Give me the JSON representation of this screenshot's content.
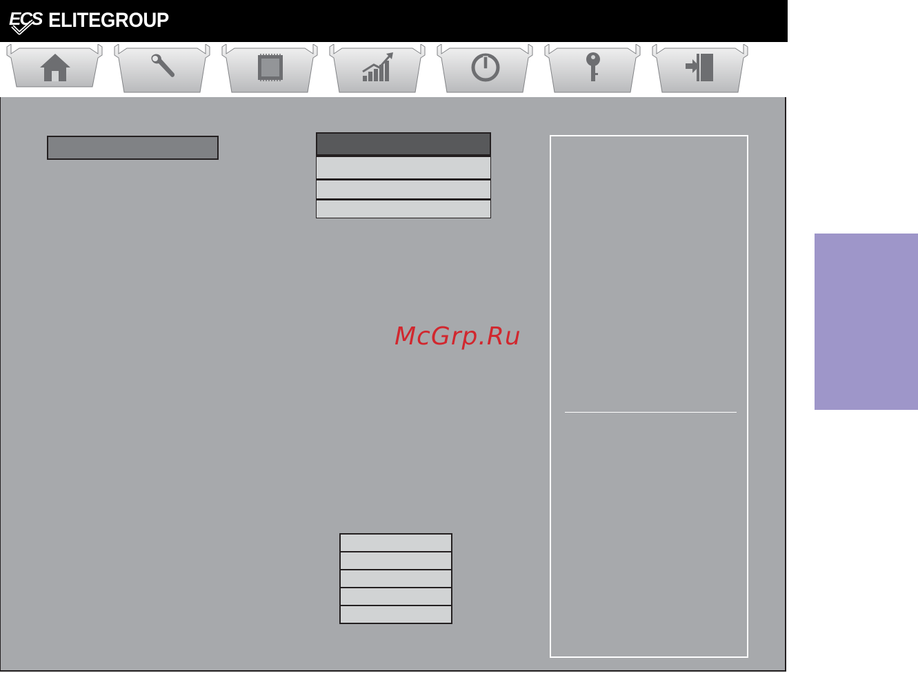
{
  "brand": {
    "mark": "ECS",
    "name": "ELITEGROUP"
  },
  "tabs": [
    {
      "id": "main",
      "icon": "home-icon",
      "active": true
    },
    {
      "id": "advanced",
      "icon": "wrench-icon"
    },
    {
      "id": "chipset",
      "icon": "chip-icon"
    },
    {
      "id": "mb-intelligent-tweaker",
      "icon": "bar-chart-icon"
    },
    {
      "id": "boot",
      "icon": "power-icon"
    },
    {
      "id": "security",
      "icon": "key-icon"
    },
    {
      "id": "exit",
      "icon": "exit-door-icon"
    }
  ],
  "watermark": "McGrp.Ru",
  "colors": {
    "header": "#000000",
    "panel": "#a7a9ac",
    "selected": "#808285",
    "option_head": "#58595b",
    "option": "#d1d3d4",
    "side_tab": "#9e96c9",
    "watermark": "#d1272e"
  }
}
